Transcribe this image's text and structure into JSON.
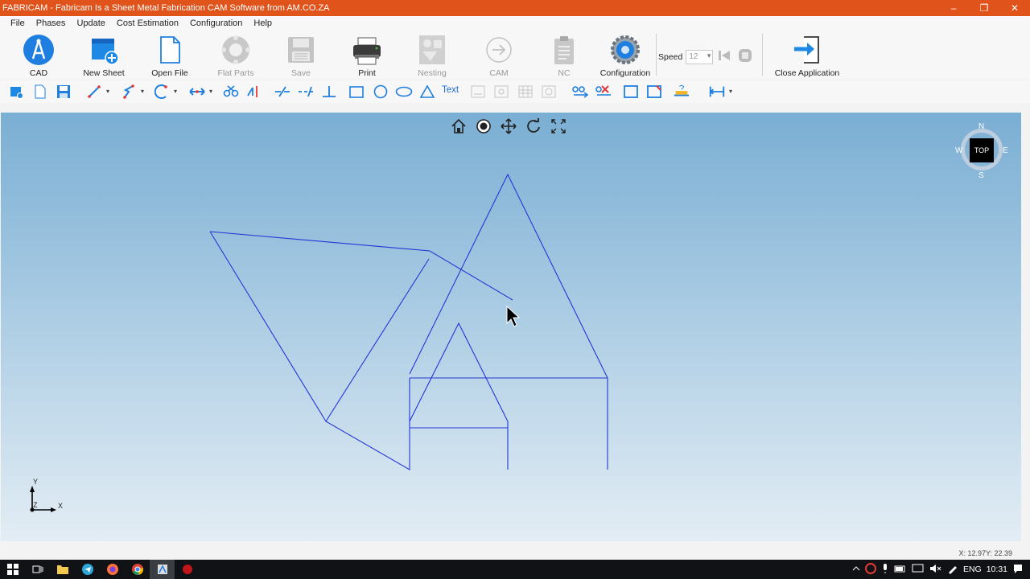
{
  "window": {
    "title": "FABRICAM - Fabricam Is a Sheet Metal Fabrication CAM Software from AM.CO.ZA",
    "minimize_glyph": "–",
    "restore_glyph": "❐",
    "close_glyph": "✕"
  },
  "menu": {
    "items": [
      "File",
      "Phases",
      "Update",
      "Cost Estimation",
      "Configuration",
      "Help"
    ]
  },
  "ribbon": {
    "cad": "CAD",
    "new_sheet": "New Sheet",
    "open_file": "Open File",
    "flat_parts": "Flat Parts",
    "save": "Save",
    "print": "Print",
    "nesting": "Nesting",
    "cam": "CAM",
    "nc": "NC",
    "configuration": "Configuration",
    "speed_label": "Speed",
    "speed_value": "12",
    "close_application": "Close Application"
  },
  "toolbar": {
    "text_tool": "Text"
  },
  "canvas": {
    "compass": {
      "n": "N",
      "s": "S",
      "e": "E",
      "w": "W",
      "view": "TOP"
    },
    "axes": {
      "y": "Y",
      "x": "X",
      "z": "Z"
    },
    "background_top": "#7aaed3",
    "background_bottom": "#e3edf4",
    "line_color": "#2436d6"
  },
  "status": {
    "coordinates": "X: 12.97Y: 22.39"
  },
  "taskbar": {
    "language": "ENG",
    "time": "10:31"
  }
}
